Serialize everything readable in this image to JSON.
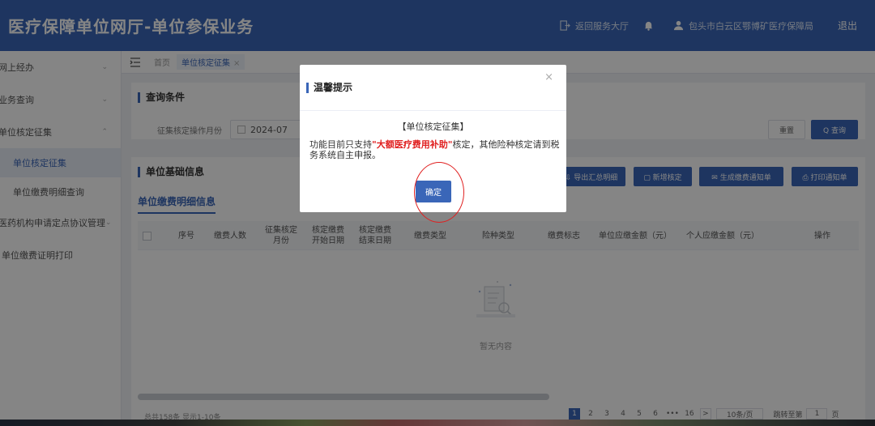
{
  "header": {
    "title": "医疗保障单位网厅-单位参保业务",
    "back_link": "返回服务大厅",
    "org_name": "包头市白云区鄂博矿医疗保障局",
    "logout": "退出"
  },
  "sidebar": {
    "items": [
      {
        "label": "网上经办",
        "chevron": "⌄"
      },
      {
        "label": "业务查询",
        "chevron": "⌄"
      },
      {
        "label": "单位核定征集",
        "chevron": "⌃"
      }
    ],
    "subitems": [
      {
        "label": "单位核定征集"
      },
      {
        "label": "单位缴费明细查询"
      }
    ],
    "items2": [
      {
        "label": "医药机构申请定点协议管理",
        "chevron": "⌄"
      },
      {
        "label": "单位缴费证明打印"
      }
    ]
  },
  "tabs": {
    "home": "首页",
    "active": "单位核定征集",
    "close": "×"
  },
  "query": {
    "section_title": "查询条件",
    "month_label": "征集核定操作月份",
    "month_value": "2024-07",
    "reset_label": "重置",
    "search_label": "Q 查询"
  },
  "basic": {
    "section_title": "单位基础信息",
    "sub_tab": "单位缴费明细信息",
    "actions": [
      "⇩ 导出汇总明细",
      "▢ 新增核定",
      "✉ 生成缴费通知单",
      "⎙ 打印通知单"
    ]
  },
  "table": {
    "columns": [
      "序号",
      "缴费人数",
      "征集核定\n月份",
      "核定缴费\n开始日期",
      "核定缴费\n结束日期",
      "缴费类型",
      "险种类型",
      "缴费标志",
      "单位应缴金额（元）",
      "个人应缴金额（元）",
      "操作"
    ],
    "empty_text": "暂无内容"
  },
  "pagination": {
    "total": "总共158条 显示1-10条",
    "pages": [
      "1",
      "2",
      "3",
      "4",
      "5",
      "6",
      "•••",
      "16"
    ],
    "next": ">",
    "page_size": "10条/页",
    "jump_label": "跳转至第",
    "jump_value": "1",
    "jump_suffix": "页"
  },
  "modal": {
    "title": "温馨提示",
    "close": "×",
    "heading": "【单位核定征集】",
    "body_before": "功能目前只支持",
    "body_highlight": "\"大额医疗费用补助\"",
    "body_after": "核定，其他险种核定请到税务系统自主申报。",
    "ok_label": "确定"
  }
}
